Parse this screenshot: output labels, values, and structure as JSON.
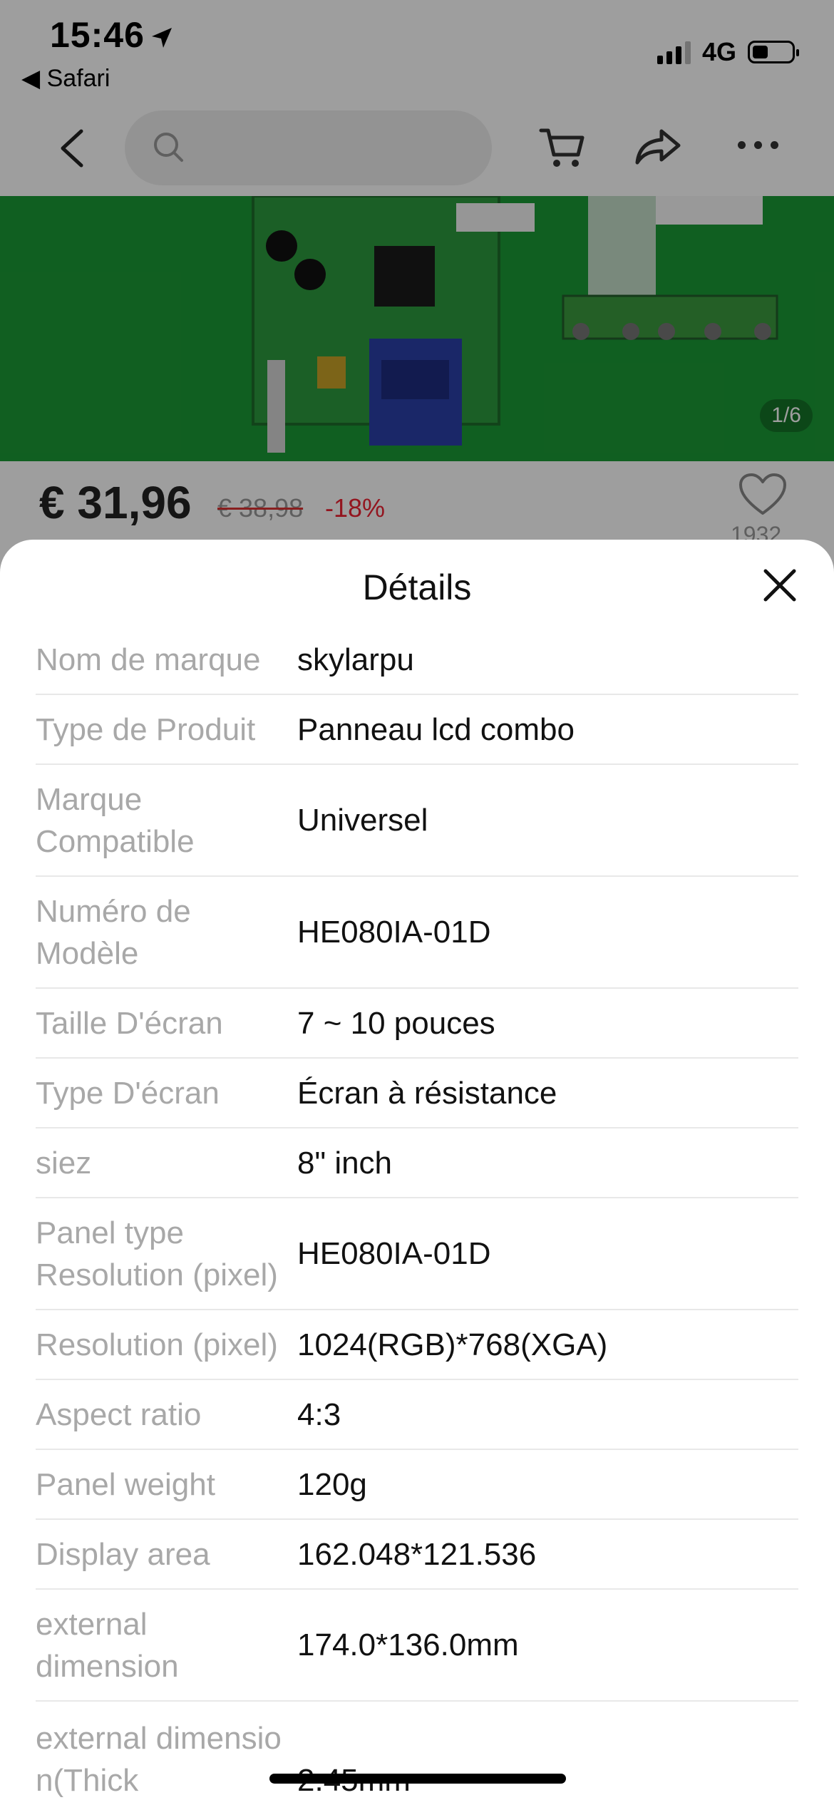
{
  "status_bar": {
    "time": "15:46",
    "back_app": "Safari",
    "network": "4G",
    "battery_level": 0.4
  },
  "toolbar": {
    "icons": [
      "back-chevron-icon",
      "search-icon",
      "cart-icon",
      "share-icon",
      "more-icon"
    ]
  },
  "product": {
    "image_counter": "1/6",
    "price": "€ 31,96",
    "old_price": "€ 38,98",
    "discount": "-18%",
    "likes": "1932"
  },
  "sheet": {
    "title": "Détails",
    "rows": [
      {
        "key": "Nom de marque",
        "value": "skylarpu"
      },
      {
        "key": "Type de Produit",
        "value": "Panneau lcd combo"
      },
      {
        "key": "Marque Compatible",
        "value": "Universel"
      },
      {
        "key": "Numéro de Modèle",
        "value": "HE080IA-01D"
      },
      {
        "key": "Taille D'écran",
        "value": "7 ~ 10 pouces"
      },
      {
        "key": "Type D'écran",
        "value": "Écran à résistance"
      },
      {
        "key": "siez",
        "value": "8\" inch"
      },
      {
        "key": "Panel type Resolution (pixel)",
        "value": "HE080IA-01D"
      },
      {
        "key": "Resolution (pixel)",
        "value": "1024(RGB)*768(XGA)"
      },
      {
        "key": "Aspect ratio",
        "value": "4:3"
      },
      {
        "key": "Panel weight",
        "value": "120g"
      },
      {
        "key": "Display area",
        "value": "162.048*121.536"
      },
      {
        "key": "external dimension",
        "value": "174.0*136.0mm"
      },
      {
        "key": "external dimension(Thick",
        "value": "2.45mm"
      }
    ]
  }
}
